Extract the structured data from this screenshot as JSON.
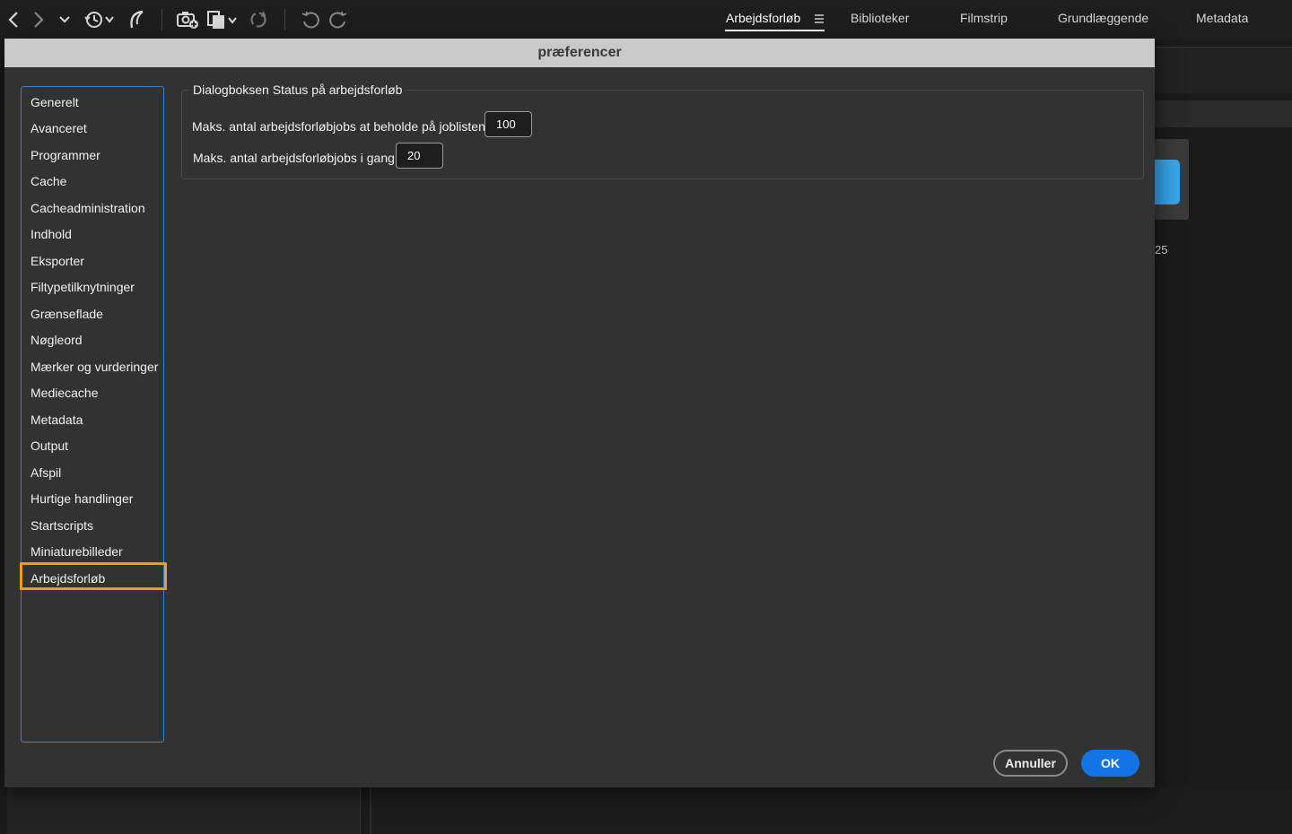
{
  "toolbar": {
    "icons": [
      "back-icon",
      "forward-icon",
      "chevron-down-icon",
      "recent-history-icon",
      "boomerang-icon",
      "camera-import-icon",
      "copy-files-icon",
      "refresh-icon",
      "rotate-left-icon",
      "rotate-right-icon"
    ]
  },
  "workspaces": {
    "tabs": [
      {
        "label": "Arbejdsforløb",
        "active": true
      },
      {
        "label": "Biblioteker"
      },
      {
        "label": "Filmstrip"
      },
      {
        "label": "Grundlæggende"
      },
      {
        "label": "Metadata"
      }
    ]
  },
  "background": {
    "count": "25"
  },
  "dialog": {
    "title": "præferencer",
    "nav": [
      "Generelt",
      "Avanceret",
      "Programmer",
      "Cache",
      "Cacheadministration",
      "Indhold",
      "Eksporter",
      "Filtypetilknytninger",
      "Grænseflade",
      "Nøgleord",
      "Mærker og vurderinger",
      "Mediecache",
      "Metadata",
      "Output",
      "Afspil",
      "Hurtige handlinger",
      "Startscripts",
      "Miniaturebilleder",
      "Arbejdsforløb"
    ],
    "selected_nav": "Arbejdsforløb",
    "group": {
      "legend": "Dialogboksen Status på arbejdsforløb",
      "field1_label": "Maks. antal arbejdsforløbjobs at beholde på joblisten",
      "field1_value": "100",
      "field2_label": "Maks. antal arbejdsforløbjobs i gang",
      "field2_value": "20"
    },
    "buttons": {
      "cancel": "Annuller",
      "ok": "OK"
    }
  },
  "colors": {
    "accent": "#1473e6",
    "selection_outline": "#f39a1b",
    "list_border": "#2f84d6"
  }
}
